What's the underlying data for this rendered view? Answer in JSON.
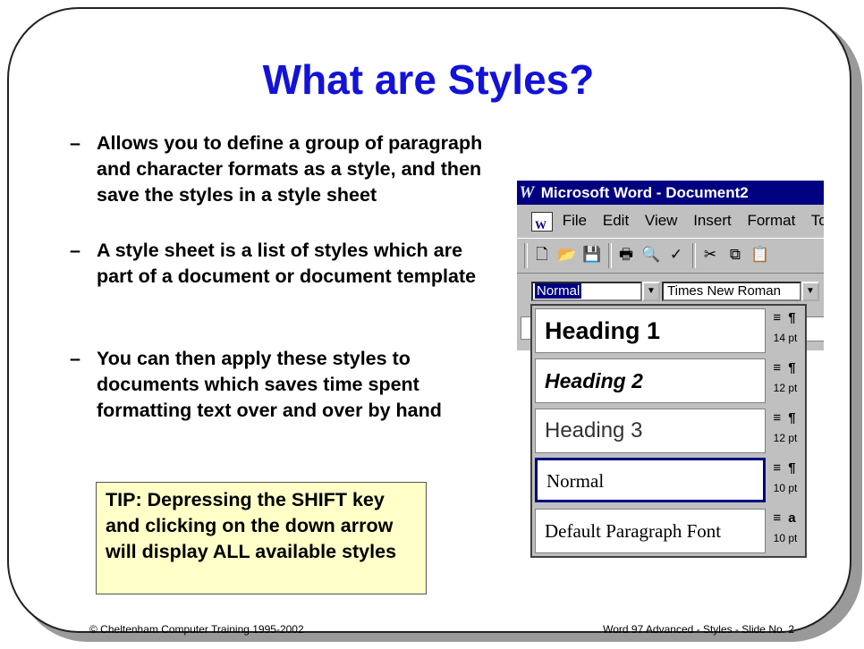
{
  "slide": {
    "title": "What are Styles?",
    "bullets": [
      {
        "marker": "–",
        "text": "Allows you to define a group of paragraph and character formats as a style, and then save the styles in a style sheet"
      },
      {
        "marker": "–",
        "text": "A style sheet is a list of styles which are part of a document or document template"
      },
      {
        "marker": "–",
        "text": "You can then apply these styles to documents which saves time spent formatting text over and over by hand"
      }
    ],
    "tip": "TIP:  Depressing the SHIFT key and clicking on the down arrow will display ALL available styles",
    "footer_left": "© Cheltenham Computer Training 1995-2002",
    "footer_right": "Word 97 Advanced - Styles - Slide No. 2"
  },
  "word": {
    "title": "Microsoft Word - Document2",
    "logo": "W",
    "menu": [
      "File",
      "Edit",
      "View",
      "Insert",
      "Format",
      "Tool"
    ],
    "toolbar_icons": [
      "new-document-icon",
      "open-folder-icon",
      "save-disk-icon",
      "print-icon",
      "print-preview-icon",
      "spelling-icon",
      "cut-icon",
      "copy-icon",
      "paste-icon"
    ],
    "style_value": "Normal",
    "font_value": "Times New Roman"
  },
  "style_list": [
    {
      "name": "Heading 1",
      "glyph": "≡ ¶",
      "size": "14 pt"
    },
    {
      "name": "Heading 2",
      "glyph": "≡ ¶",
      "size": "12 pt"
    },
    {
      "name": "Heading 3",
      "glyph": "≡ ¶",
      "size": "12 pt"
    },
    {
      "name": "Normal",
      "glyph": "≡ ¶",
      "size": "10 pt"
    },
    {
      "name": "Default Paragraph Font",
      "glyph": "≡ a",
      "size": "10 pt"
    }
  ],
  "colors": {
    "title": "#1212d8",
    "tip_bg": "#ffffc8",
    "titlebar": "#000080"
  }
}
